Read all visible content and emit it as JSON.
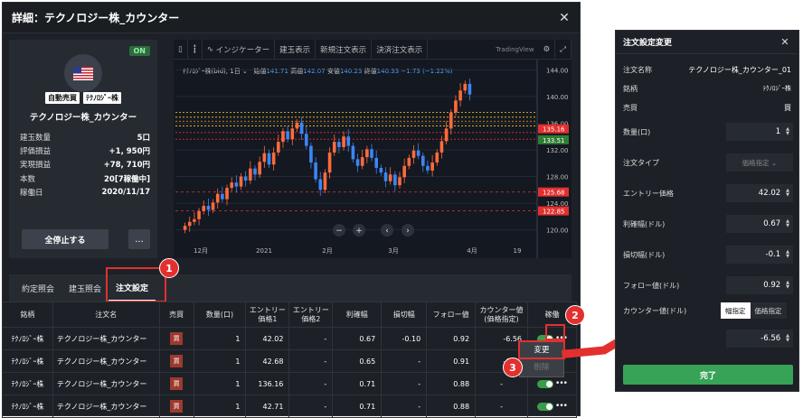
{
  "window": {
    "title": "詳細：テクノロジー株_カウンター"
  },
  "info": {
    "status": "ON",
    "tags": [
      "自動売買",
      "ﾃｸﾉﾛｼﾞｰ株"
    ],
    "name": "テクノロジー株_カウンター",
    "stats": [
      {
        "label": "建玉数量",
        "value": "5口"
      },
      {
        "label": "評価損益",
        "value": "+1, 950円"
      },
      {
        "label": "実現損益",
        "value": "+78, 710円"
      },
      {
        "label": "本数",
        "value": "20[7稼働中]"
      },
      {
        "label": "稼働日",
        "value": "2020/11/17"
      }
    ],
    "stop_all_label": "全停止する",
    "more_label": "..."
  },
  "chart_toolbar": {
    "items": [
      "日",
      "インジケーター",
      "建玉表示",
      "新規注文表示",
      "決済注文表示"
    ],
    "brand": "TradingView"
  },
  "chart_legend": {
    "symbol": "ﾃｸﾉﾛｼﾞｰ株(bid), 1日",
    "open_label": "始値",
    "open": "141.71",
    "high_label": "高値",
    "high": "142.07",
    "low_label": "安値",
    "low": "140.23",
    "close_label": "終値",
    "close": "140.33",
    "change": "−1.73 (−1.22%)"
  },
  "chart_data": {
    "type": "candlestick",
    "ylim": [
      119,
      145
    ],
    "y_ticks": [
      "144.00",
      "140.00",
      "136.00",
      "132.00",
      "128.00",
      "124.00",
      "120.00"
    ],
    "x_ticks": [
      "12月",
      "2021",
      "2月",
      "3月",
      "4月",
      "19"
    ],
    "price_tags": [
      {
        "label": "135.16",
        "value": 135.16,
        "color": "#e3302f"
      },
      {
        "label": "133.51",
        "value": 133.51,
        "color": "#2e7d32"
      },
      {
        "label": "125.68",
        "value": 125.68,
        "color": "#e3302f"
      },
      {
        "label": "122.85",
        "value": 122.85,
        "color": "#e3302f"
      }
    ],
    "closes": [
      120.6,
      121.2,
      121.6,
      122.8,
      123.6,
      123.0,
      124.1,
      125.4,
      124.6,
      126.3,
      127.1,
      126.5,
      128.0,
      127.4,
      129.2,
      128.3,
      130.2,
      131.5,
      129.8,
      131.6,
      133.2,
      134.8,
      133.6,
      135.2,
      136.1,
      134.4,
      132.6,
      130.1,
      127.6,
      126.0,
      128.6,
      131.6,
      133.2,
      132.4,
      134.0,
      132.6,
      130.6,
      129.6,
      130.9,
      132.1,
      130.8,
      129.3,
      128.6,
      127.3,
      128.3,
      126.7,
      127.9,
      129.6,
      130.8,
      131.9,
      131.1,
      129.6,
      128.9,
      130.1,
      131.6,
      133.3,
      135.2,
      137.6,
      139.4,
      140.9,
      141.9,
      140.3
    ]
  },
  "tabs": [
    "約定照会",
    "建玉照会",
    "注文設定"
  ],
  "table": {
    "headers": [
      "銘柄",
      "注文名",
      "売買",
      "数量(口)",
      "エントリー価格1",
      "エントリー価格2",
      "利確幅",
      "損切幅",
      "フォロー値",
      "カウンター値(価格指定)",
      "稼働"
    ],
    "rows": [
      [
        "ﾃｸﾉﾛｼﾞｰ株",
        "テクノロジー株_カウンター",
        "買",
        "1",
        "42.02",
        "-",
        "0.67",
        "-0.10",
        "0.92",
        "-6.56"
      ],
      [
        "ﾃｸﾉﾛｼﾞｰ株",
        "テクノロジー株_カウンター",
        "買",
        "1",
        "42.68",
        "-",
        "0.65",
        "-",
        "0.91",
        "-6.60"
      ],
      [
        "ﾃｸﾉﾛｼﾞｰ株",
        "テクノロジー株_カウンター",
        "買",
        "1",
        "136.16",
        "-",
        "0.71",
        "-",
        "0.88",
        "-"
      ],
      [
        "ﾃｸﾉﾛｼﾞｰ株",
        "テクノロジー株_カウンター",
        "買",
        "1",
        "42.71",
        "-",
        "0.71",
        "-",
        "0.88",
        "-"
      ]
    ]
  },
  "menu": {
    "edit": "変更",
    "delete": "削除"
  },
  "markers": [
    "1",
    "2",
    "3"
  ],
  "panel": {
    "title": "注文設定変更",
    "order_name_label": "注文名称",
    "order_name": "テクノロジー株_カウンター_01",
    "symbol_label": "銘柄",
    "symbol": "ﾃｸﾉﾛｼﾞｰ株",
    "side_label": "売買",
    "side": "買",
    "qty_label": "数量(口)",
    "qty": "1",
    "order_type_label": "注文タイプ",
    "order_type_placeholder": "価格指定",
    "entry_label": "エントリー価格",
    "entry": "42.02",
    "take_profit_label": "利確幅(ドル)",
    "take_profit": "0.67",
    "stop_loss_label": "損切幅(ドル)",
    "stop_loss": "-0.1",
    "follow_label": "フォロー値(ドル)",
    "follow": "0.92",
    "counter_label": "カウンター値(ドル)",
    "counter_mode_1": "幅指定",
    "counter_mode_2": "価格指定",
    "counter": "-6.56",
    "done_label": "完了"
  },
  "colors": {
    "up": "#ff6b3d",
    "down": "#3b86f5",
    "accent_red": "#e3302f",
    "accent_green": "#36a357"
  }
}
